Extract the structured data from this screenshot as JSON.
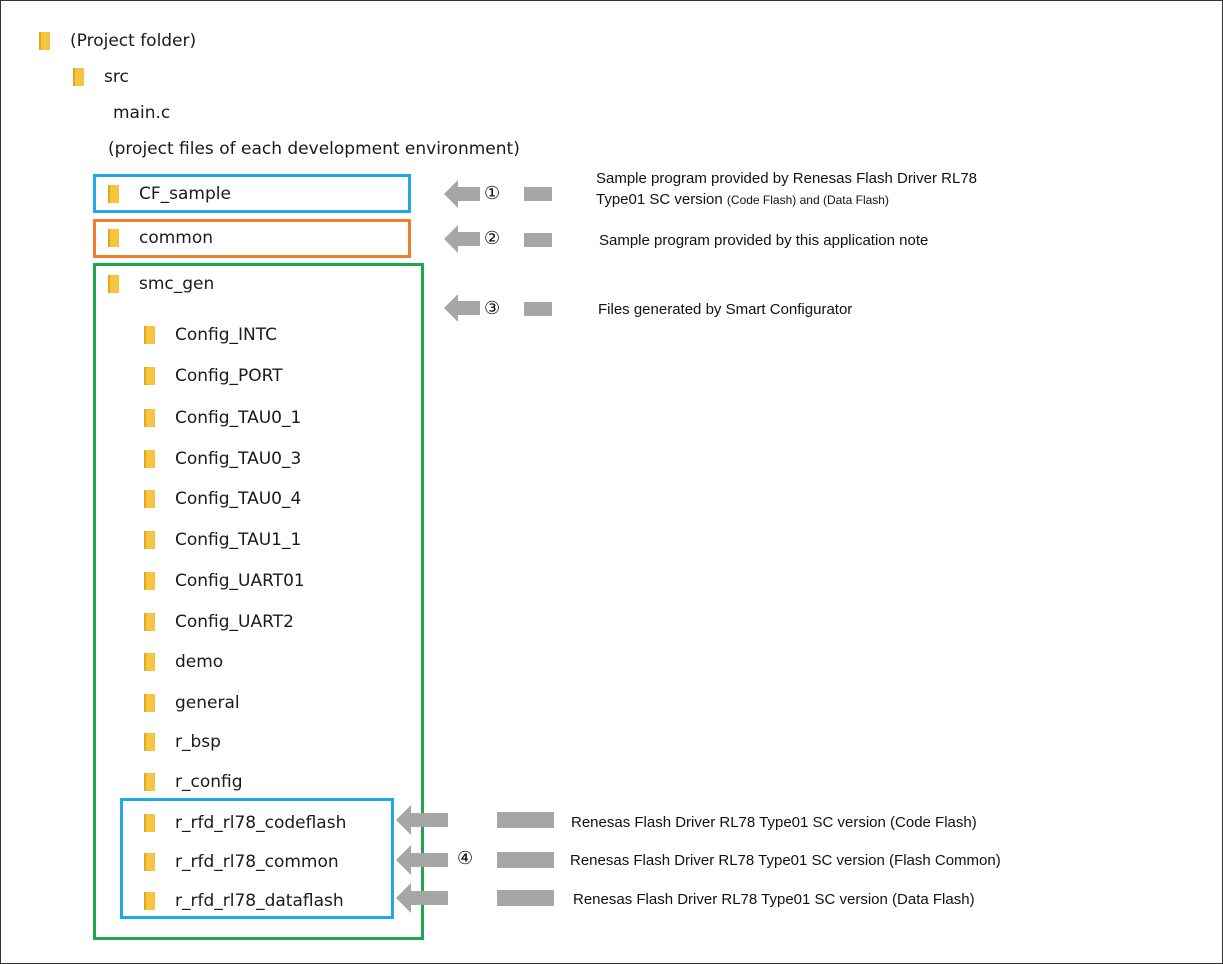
{
  "tree": {
    "project": "(Project folder)",
    "src": "src",
    "main_c": "main.c",
    "project_files": "(project files of each development environment)",
    "cf_sample": "CF_sample",
    "common": "common",
    "smc_gen": "smc_gen",
    "smc_children": [
      "Config_INTC",
      "Config_PORT",
      "Config_TAU0_1",
      "Config_TAU0_3",
      "Config_TAU0_4",
      "Config_TAU1_1",
      "Config_UART01",
      "Config_UART2",
      "demo",
      "general",
      "r_bsp",
      "r_config",
      "r_rfd_rl78_codeflash",
      "r_rfd_rl78_common",
      "r_rfd_rl78_dataflash"
    ]
  },
  "callouts": {
    "n1": "①",
    "n2": "②",
    "n3": "③",
    "n4": "④",
    "note1_line1": "Sample program provided by Renesas Flash Driver RL78",
    "note1_line2_a": "Type01 SC version",
    "note1_line2_b": "(Code Flash) and (Data Flash)",
    "note2": "Sample program provided by this application note",
    "note3": "Files generated by Smart Configurator",
    "note4a": "Renesas Flash Driver RL78 Type01 SC version (Code Flash)",
    "note4b": "Renesas Flash Driver RL78 Type01 SC version (Flash Common)",
    "note4c": "Renesas Flash Driver RL78 Type01 SC version (Data Flash)"
  },
  "colors": {
    "box1": "#1fa9e6",
    "box2": "#ed7d31",
    "box3": "#1ea64a",
    "box4": "#1fa9e6",
    "arrow": "#a6a6a6",
    "folder": "#f5c541"
  }
}
